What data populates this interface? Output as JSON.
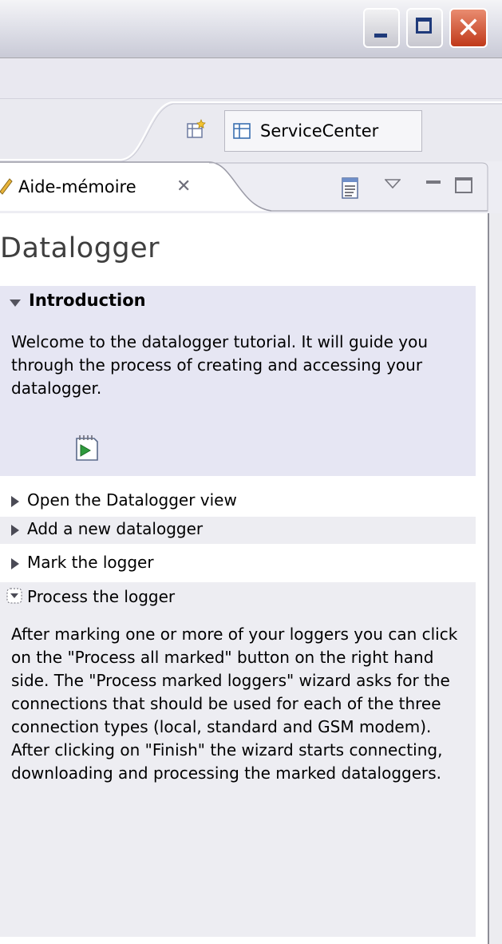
{
  "window": {
    "controls": [
      "minimize-button",
      "maximize-button",
      "close-button"
    ],
    "close_glyph": "✕"
  },
  "perspective": {
    "active": "ServiceCenter"
  },
  "view": {
    "tab_label": "Aide-mémoire",
    "tab_close_glyph": "✕"
  },
  "cheatsheet": {
    "title": "Datalogger",
    "intro": {
      "title": "Introduction",
      "text": "Welcome to the datalogger tutorial. It will guide you through the process of creating and accessing your datalogger."
    },
    "steps": [
      {
        "label": "Open the Datalogger view"
      },
      {
        "label": "Add a new datalogger"
      },
      {
        "label": "Mark the logger"
      }
    ],
    "expanded_step": {
      "title": "Process the logger",
      "text": "After marking one or more of your loggers you can click on the \"Process all marked\" button on the right hand side. The \"Process marked loggers\" wizard asks for the connections that should be used for each of the three connection types (local, standard and GSM modem). After clicking on \"Finish\" the wizard starts connecting, downloading and processing the marked dataloggers."
    }
  }
}
